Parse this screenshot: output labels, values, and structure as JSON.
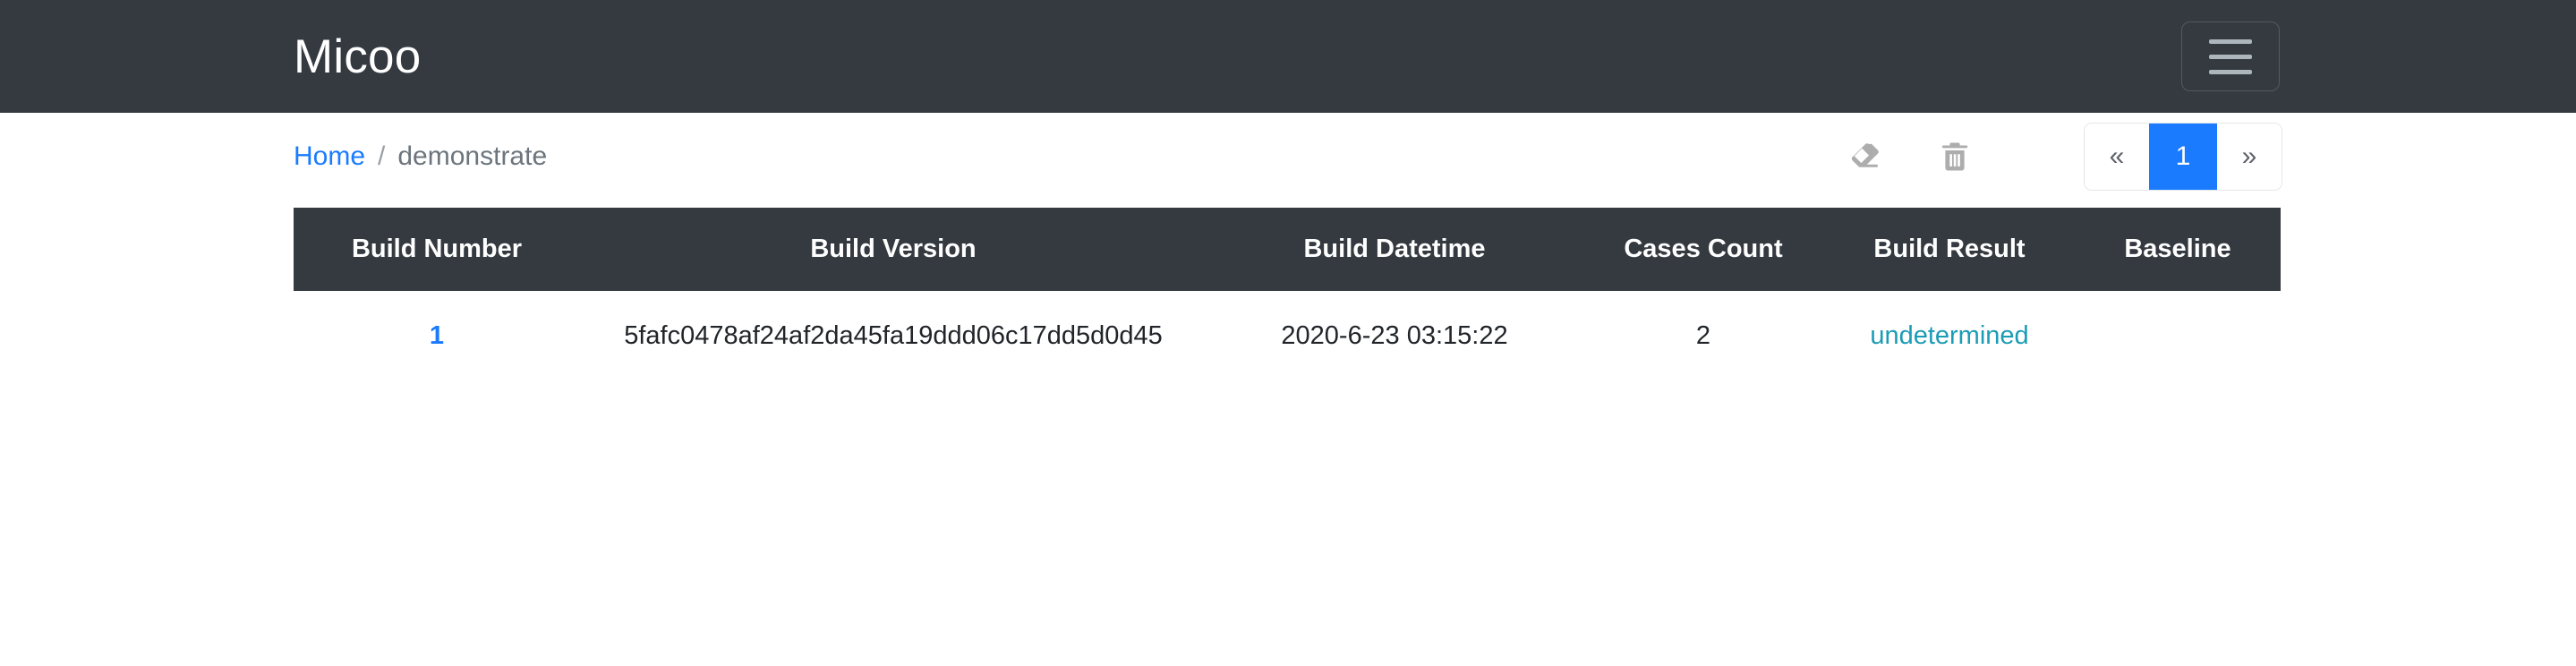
{
  "navbar": {
    "brand": "Micoo",
    "toggler_label": "toggle-navigation"
  },
  "breadcrumb": {
    "home": "Home",
    "separator": "/",
    "current": "demonstrate"
  },
  "actions": {
    "eraser_icon": "eraser-icon",
    "trash_icon": "trash-icon"
  },
  "pagination": {
    "prev": "«",
    "pages": [
      "1"
    ],
    "next": "»",
    "active_page": "1"
  },
  "table": {
    "headers": [
      "Build Number",
      "Build Version",
      "Build Datetime",
      "Cases Count",
      "Build Result",
      "Baseline"
    ],
    "rows": [
      {
        "build_number": "1",
        "build_version": "5fafc0478af24af2da45fa19ddd06c17dd5d0d45",
        "build_datetime": "2020-6-23 03:15:22",
        "cases_count": "2",
        "build_result": "undetermined",
        "baseline": ""
      }
    ]
  },
  "colors": {
    "navbar_bg": "#343a40",
    "link_blue": "#1a7bff",
    "result_teal": "#1b9cb5",
    "muted_gray": "#6c757d",
    "icon_gray": "#adadad"
  }
}
